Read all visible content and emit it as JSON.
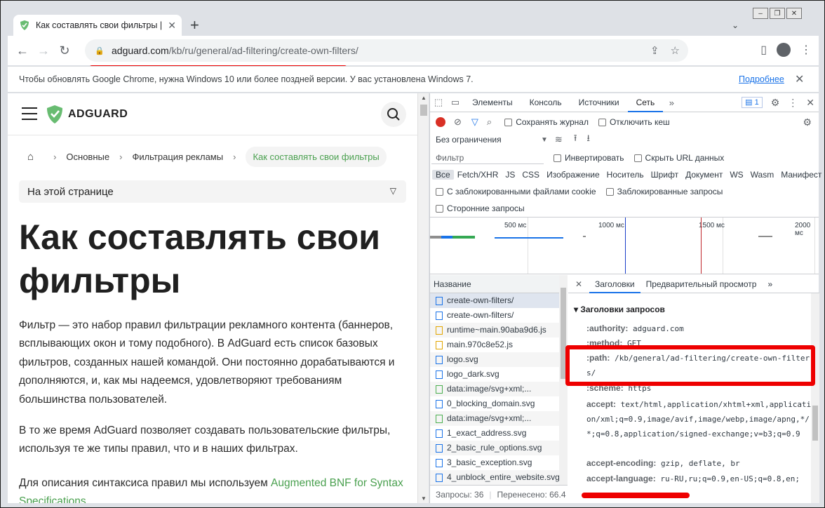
{
  "browser": {
    "tab_title": "Как составлять свои фильтры | AdG",
    "url_host": "adguard.com",
    "url_path": "/kb/ru/general/ad-filtering/create-own-filters/",
    "infobar_message": "Чтобы обновлять Google Chrome, нужна Windows 10 или более поздней версии. У вас установлена Windows 7.",
    "infobar_link": "Подробнее"
  },
  "page": {
    "logo_text": "ADGUARD",
    "breadcrumbs": [
      "Основные",
      "Фильтрация рекламы"
    ],
    "breadcrumb_current": "Как составлять свои фильтры",
    "toc_label": "На этой странице",
    "title": "Как составлять свои фильтры",
    "para1": "Фильтр — это набор правил фильтрации рекламного контента (баннеров, всплывающих окон и тому подобного). В AdGuard есть список базовых фильтров, созданных нашей командой. Они постоянно дорабатываются и дополняются, и, как мы надеемся, удовлетворяют требованиям большинства пользователей.",
    "para2": "В то же время AdGuard позволяет создавать пользовательские фильтры, используя те же типы правил, что и в наших фильтрах.",
    "para3_text": "Для описания синтаксиса правил мы используем ",
    "para3_link": "Augmented BNF for Syntax Specifications"
  },
  "devtools": {
    "tabs": [
      "Элементы",
      "Консоль",
      "Источники",
      "Сеть"
    ],
    "active_tab": "Сеть",
    "issues_count": "1",
    "preserve_log": "Сохранять журнал",
    "disable_cache": "Отключить кеш",
    "throttling": "Без ограничения",
    "filter_placeholder": "Фильтр",
    "invert": "Инвертировать",
    "hide_urls": "Скрыть URL данных",
    "types": [
      "Все",
      "Fetch/XHR",
      "JS",
      "CSS",
      "Изображение",
      "Носитель",
      "Шрифт",
      "Документ",
      "WS",
      "Wasm",
      "Манифест"
    ],
    "blocked_cookies": "С заблокированными файлами cookie",
    "blocked_requests": "Заблокированные запросы",
    "third_party": "Сторонние запросы",
    "timeline_ticks": [
      "500 мс",
      "1000 мс",
      "1500 мс",
      "2000 мс"
    ],
    "name_header": "Название",
    "files": [
      {
        "name": "create-own-filters/",
        "kind": "doc"
      },
      {
        "name": "create-own-filters/",
        "kind": "doc"
      },
      {
        "name": "runtime~main.90aba9d6.js",
        "kind": "js"
      },
      {
        "name": "main.970c8e52.js",
        "kind": "js"
      },
      {
        "name": "logo.svg",
        "kind": "doc"
      },
      {
        "name": "logo_dark.svg",
        "kind": "doc"
      },
      {
        "name": "data:image/svg+xml;...",
        "kind": "img"
      },
      {
        "name": "0_blocking_domain.svg",
        "kind": "doc"
      },
      {
        "name": "data:image/svg+xml;...",
        "kind": "img"
      },
      {
        "name": "1_exact_address.svg",
        "kind": "doc"
      },
      {
        "name": "2_basic_rule_options.svg",
        "kind": "doc"
      },
      {
        "name": "3_basic_exception.svg",
        "kind": "doc"
      },
      {
        "name": "4_unblock_entire_website.svg",
        "kind": "doc"
      }
    ],
    "requests_status": "Запросы: 36",
    "transferred_status": "Перенесено: 66.4",
    "detail_tabs": [
      "Заголовки",
      "Предварительный просмотр"
    ],
    "section_title": "Заголовки запросов",
    "headers": [
      {
        "k": ":authority:",
        "v": "adguard.com"
      },
      {
        "k": ":method:",
        "v": "GET"
      },
      {
        "k": ":path:",
        "v": "/kb/general/ad-filtering/create-own-filters/"
      },
      {
        "k": ":scheme:",
        "v": "https"
      },
      {
        "k": "accept:",
        "v": "text/html,application/xhtml+xml,application/xml;q=0.9,image/avif,image/webp,image/apng,*/*;q=0.8,application/signed-exchange;v=b3;q=0.9"
      },
      {
        "k": "accept-encoding:",
        "v": "gzip, deflate, br"
      },
      {
        "k": "accept-language:",
        "v": "ru-RU,ru;q=0.9,en-US;q=0.8,en;"
      }
    ]
  }
}
